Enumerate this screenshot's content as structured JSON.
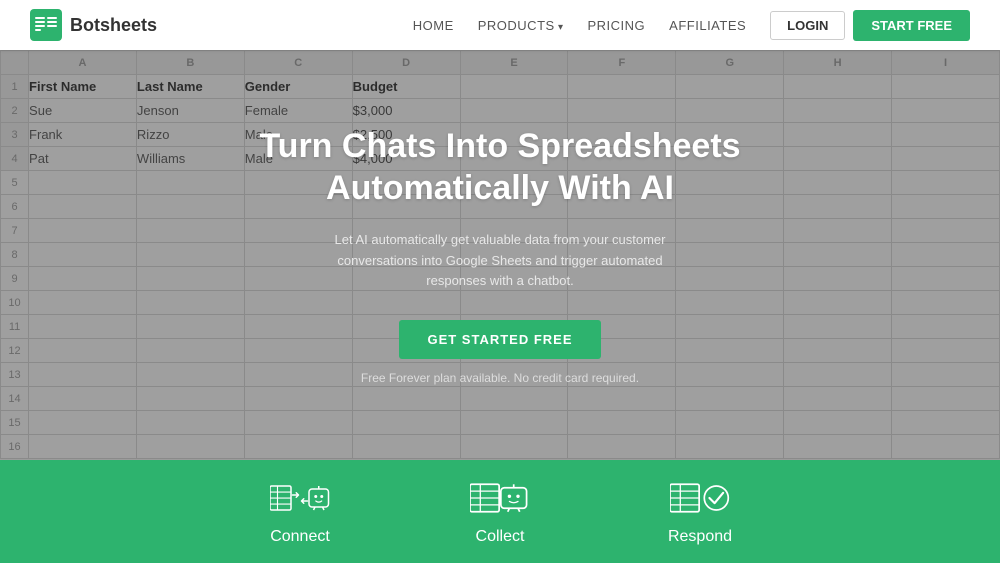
{
  "navbar": {
    "logo_text": "Botsheets",
    "links": [
      {
        "label": "HOME",
        "has_arrow": false
      },
      {
        "label": "PRODUCTS",
        "has_arrow": true
      },
      {
        "label": "PRICING",
        "has_arrow": false
      },
      {
        "label": "AFFILIATES",
        "has_arrow": false
      }
    ],
    "login_label": "LOGIN",
    "start_label": "START FREE"
  },
  "spreadsheet": {
    "columns": [
      "A",
      "B",
      "C",
      "D",
      "E",
      "F",
      "G",
      "H",
      "I"
    ],
    "headers": [
      "First Name",
      "Last Name",
      "Gender",
      "Budget",
      "",
      "",
      "",
      ""
    ],
    "rows": [
      [
        "Sue",
        "Jenson",
        "Female",
        "$3,000",
        "",
        "",
        "",
        ""
      ],
      [
        "Frank",
        "Rizzo",
        "Male",
        "$2,500",
        "",
        "",
        "",
        ""
      ],
      [
        "Pat",
        "Williams",
        "Male",
        "$4,000",
        "",
        "",
        "",
        ""
      ],
      [
        "",
        "",
        "",
        "",
        "",
        "",
        "",
        ""
      ],
      [
        "",
        "",
        "",
        "",
        "",
        "",
        "",
        ""
      ],
      [
        "",
        "",
        "",
        "",
        "",
        "",
        "",
        ""
      ],
      [
        "",
        "",
        "",
        "",
        "",
        "",
        "",
        ""
      ],
      [
        "",
        "",
        "",
        "",
        "",
        "",
        "",
        ""
      ],
      [
        "",
        "",
        "",
        "",
        "",
        "",
        "",
        ""
      ],
      [
        "",
        "",
        "",
        "",
        "",
        "",
        "",
        ""
      ],
      [
        "",
        "",
        "",
        "",
        "",
        "",
        "",
        ""
      ],
      [
        "",
        "",
        "",
        "",
        "",
        "",
        "",
        ""
      ],
      [
        "",
        "",
        "",
        "",
        "",
        "",
        "",
        ""
      ]
    ]
  },
  "hero": {
    "title_line1": "Turn Chats Into Spreadsheets",
    "title_line2": "Automatically With AI",
    "subtitle": "Let AI automatically get valuable data from your customer conversations into Google Sheets and trigger automated responses with a chatbot.",
    "cta_label": "GET STARTED FREE",
    "note": "Free Forever plan available. No credit card required."
  },
  "features": [
    {
      "label": "Connect",
      "icon": "connect-icon"
    },
    {
      "label": "Collect",
      "icon": "collect-icon"
    },
    {
      "label": "Respond",
      "icon": "respond-icon"
    }
  ]
}
